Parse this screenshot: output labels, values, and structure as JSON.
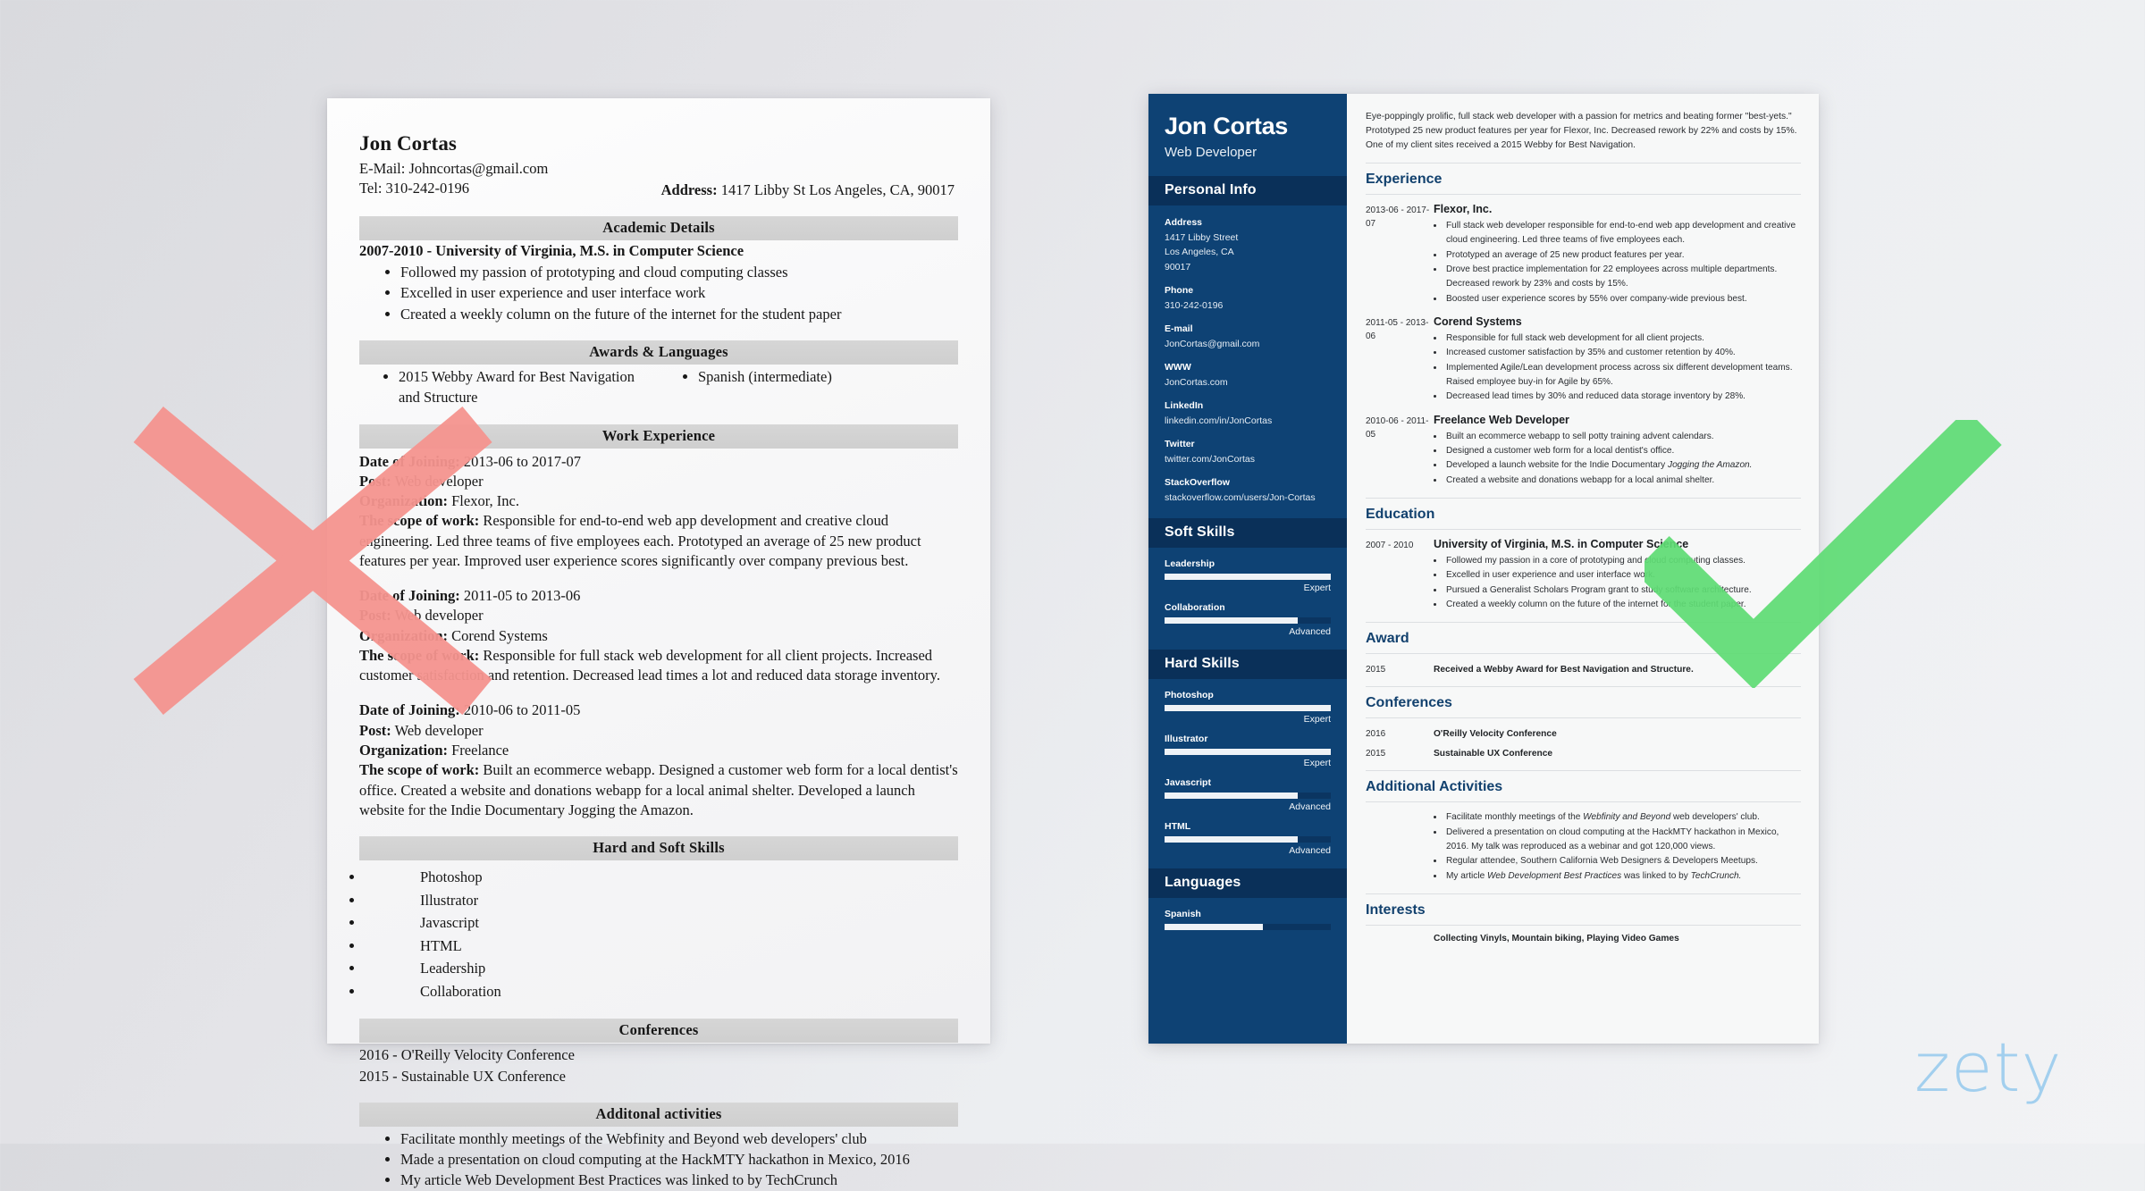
{
  "bad_resume": {
    "name": "Jon Cortas",
    "email_line": "E-Mail: Johncortas@gmail.com",
    "tel_line": "Tel: 310-242-0196",
    "address_label": "Address:",
    "address_value": "1417 Libby St Los Angeles, CA, 90017",
    "sections": {
      "academic": "Academic Details",
      "awards": "Awards & Languages",
      "work": "Work Experience",
      "skills": "Hard and Soft Skills",
      "conferences": "Conferences",
      "additional": "Additonal activities"
    },
    "academic": {
      "heading": "2007-2010 - University of Virginia, M.S. in Computer Science",
      "bullets": [
        "Followed my passion of prototyping and cloud computing classes",
        "Excelled in user experience and user interface work",
        "Created a weekly column on the future of the internet for the student paper"
      ]
    },
    "awards": {
      "left": "2015 Webby Award for Best Navigation and Structure",
      "right": "Spanish (intermediate)"
    },
    "jobs": [
      {
        "date_label": "Date of Joining:",
        "date_value": "2013-06 to 2017-07",
        "post_label": "Post:",
        "post_value": "Web developer",
        "org_label": "Organization:",
        "org_value": "Flexor, Inc.",
        "scope_label": "The scope of work:",
        "scope_value": "Responsible for end-to-end web app development and creative cloud engineering. Led three teams of five employees each. Prototyped an average of 25 new product features per year. Improved user experience scores significantly over company previous best."
      },
      {
        "date_label": "Date of Joining:",
        "date_value": "2011-05 to 2013-06",
        "post_label": "Post:",
        "post_value": "Web developer",
        "org_label": "Organization:",
        "org_value": "Corend Systems",
        "scope_label": "The scope of work:",
        "scope_value": "Responsible for full stack web development for all client projects. Increased customer satisfaction and retention. Decreased lead times a lot and reduced data storage inventory."
      },
      {
        "date_label": "Date of Joining:",
        "date_value": "2010-06 to 2011-05",
        "post_label": "Post:",
        "post_value": "Web developer",
        "org_label": "Organization:",
        "org_value": "Freelance",
        "scope_label": "The scope of work:",
        "scope_value": "Built an ecommerce webapp. Designed a customer web form for a local dentist's office. Created a website and donations webapp for a local animal shelter. Developed a launch website for the Indie Documentary Jogging the Amazon."
      }
    ],
    "skills": [
      "Photoshop",
      "Illustrator",
      "Javascript",
      "HTML",
      "Leadership",
      "Collaboration"
    ],
    "conferences": [
      "2016 - O'Reilly Velocity Conference",
      "2015 - Sustainable UX Conference"
    ],
    "additional": [
      "Facilitate monthly meetings of the Webfinity and Beyond web developers' club",
      "Made a presentation on cloud computing at the HackMTY hackathon in Mexico, 2016",
      "My article Web Development Best Practices was linked to by TechCrunch"
    ]
  },
  "good_resume": {
    "sidebar": {
      "name": "Jon Cortas",
      "title": "Web Developer",
      "personal_info_heading": "Personal Info",
      "contacts": [
        {
          "label": "Address",
          "lines": [
            "1417 Libby Street",
            "Los Angeles, CA",
            "90017"
          ]
        },
        {
          "label": "Phone",
          "lines": [
            "310-242-0196"
          ]
        },
        {
          "label": "E-mail",
          "lines": [
            "JonCortas@gmail.com"
          ]
        },
        {
          "label": "WWW",
          "lines": [
            "JonCortas.com"
          ]
        },
        {
          "label": "LinkedIn",
          "lines": [
            "linkedin.com/in/JonCortas"
          ]
        },
        {
          "label": "Twitter",
          "lines": [
            "twitter.com/JonCortas"
          ]
        },
        {
          "label": "StackOverflow",
          "lines": [
            "stackoverflow.com/users/Jon-Cortas"
          ]
        }
      ],
      "soft_skills_heading": "Soft Skills",
      "soft_skills": [
        {
          "name": "Leadership",
          "level": "Expert",
          "pct": 100
        },
        {
          "name": "Collaboration",
          "level": "Advanced",
          "pct": 80
        }
      ],
      "hard_skills_heading": "Hard Skills",
      "hard_skills": [
        {
          "name": "Photoshop",
          "level": "Expert",
          "pct": 100
        },
        {
          "name": "Illustrator",
          "level": "Expert",
          "pct": 100
        },
        {
          "name": "Javascript",
          "level": "Advanced",
          "pct": 80
        },
        {
          "name": "HTML",
          "level": "Advanced",
          "pct": 80
        }
      ],
      "languages_heading": "Languages",
      "languages": [
        {
          "name": "Spanish",
          "level": "",
          "pct": 59
        }
      ]
    },
    "main": {
      "summary": "Eye-poppingly prolific, full stack web developer with a passion for metrics and beating former \"best-yets.\" Prototyped 25 new product features per year for Flexor, Inc. Decreased rework by 22% and costs by 15%. One of my client sites received a 2015 Webby for Best Navigation.",
      "experience_heading": "Experience",
      "experience": [
        {
          "dates": "2013-06 - 2017-07",
          "title": "Flexor, Inc.",
          "bullets": [
            "Full stack web developer responsible for end-to-end web app development and creative cloud engineering. Led three teams of five employees each.",
            "Prototyped an average of 25 new product features per year.",
            "Drove best practice implementation for 22 employees across multiple departments. Decreased rework by 23% and costs by 15%.",
            "Boosted user experience scores by 55% over company-wide previous best."
          ]
        },
        {
          "dates": "2011-05 - 2013-06",
          "title": "Corend Systems",
          "bullets": [
            "Responsible for full stack web development for all client projects.",
            "Increased customer satisfaction by 35% and customer retention by 40%.",
            "Implemented Agile/Lean development process across six different development teams. Raised employee buy-in for Agile by 65%.",
            "Decreased lead times by 30% and reduced data storage inventory by 28%."
          ]
        },
        {
          "dates": "2010-06 - 2011-05",
          "title": "Freelance Web Developer",
          "bullets": [
            "Built an ecommerce webapp to sell potty training advent calendars.",
            "Designed a customer web form for a local dentist's office.",
            "Developed a launch website for the Indie Documentary Jogging the Amazon.",
            "Created a website and donations webapp for a local animal shelter."
          ]
        }
      ],
      "education_heading": "Education",
      "education": [
        {
          "dates": "2007 - 2010",
          "title": "University of Virginia, M.S. in Computer Science",
          "bullets": [
            "Followed my passion in a core of prototyping and cloud computing classes.",
            "Excelled in user experience and user interface work.",
            "Pursued a Generalist Scholars Program grant to study software architecture.",
            "Created a weekly column on the future of the internet for the student paper."
          ]
        }
      ],
      "award_heading": "Award",
      "awards": [
        {
          "year": "2015",
          "text": "Received a Webby Award for Best Navigation and Structure."
        }
      ],
      "conferences_heading": "Conferences",
      "conferences": [
        {
          "year": "2016",
          "text": "O'Reilly Velocity Conference"
        },
        {
          "year": "2015",
          "text": "Sustainable UX Conference"
        }
      ],
      "additional_heading": "Additional Activities",
      "additional": [
        "Facilitate monthly meetings of the Webfinity and Beyond web developers' club.",
        "Delivered a presentation on cloud computing at the HackMTY hackathon in Mexico, 2016. My talk was reproduced as a webinar and got 120,000 views.",
        "Regular attendee, Southern California Web Designers & Developers Meetups.",
        "My article Web Development Best Practices was linked to by TechCrunch."
      ],
      "interests_heading": "Interests",
      "interests": "Collecting Vinyls, Mountain biking, Playing Video Games"
    }
  },
  "marks": {
    "reject_label": "rejected-x-mark",
    "accept_label": "approved-check-mark",
    "reject_color": "#f5948f",
    "accept_color": "#5fdc74"
  },
  "branding": {
    "logo_text": "zety",
    "logo_color": "#9ccdee"
  }
}
